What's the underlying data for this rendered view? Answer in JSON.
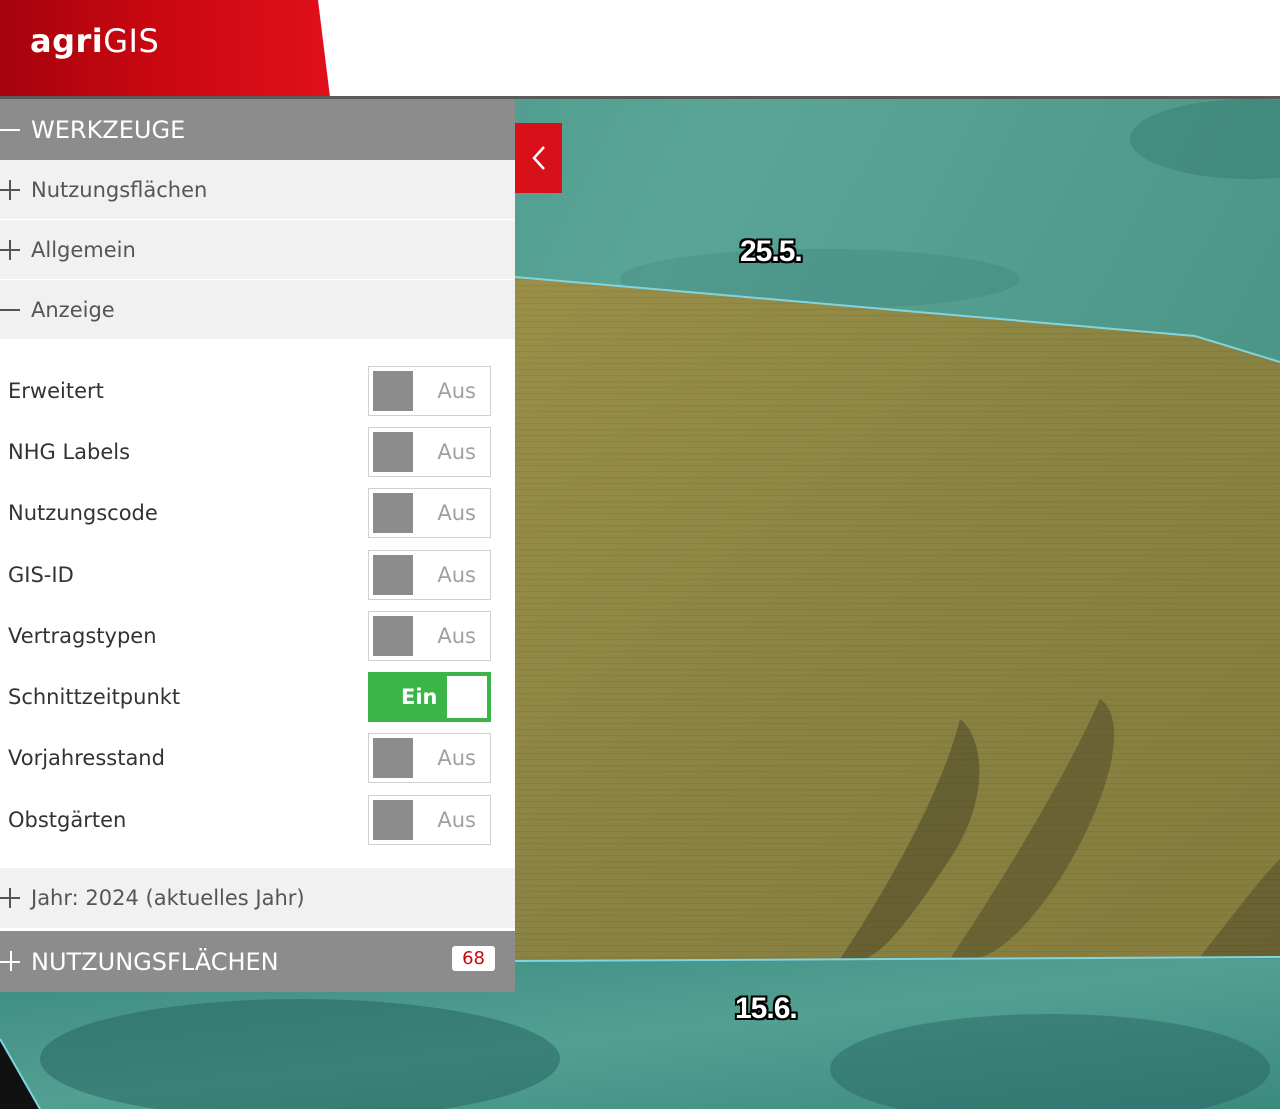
{
  "header": {
    "logo_bold": "agri",
    "logo_regular": "GIS"
  },
  "panel": {
    "werkzeuge_title": "WERKZEUGE",
    "sub_sections": [
      {
        "label": "Nutzungsflächen",
        "state": "collapsed"
      },
      {
        "label": "Allgemein",
        "state": "collapsed"
      },
      {
        "label": "Anzeige",
        "state": "expanded"
      }
    ],
    "settings": [
      {
        "label": "Erweitert",
        "value": "Aus"
      },
      {
        "label": "NHG Labels",
        "value": "Aus"
      },
      {
        "label": "Nutzungscode",
        "value": "Aus"
      },
      {
        "label": "GIS-ID",
        "value": "Aus"
      },
      {
        "label": "Vertragstypen",
        "value": "Aus"
      },
      {
        "label": "Schnittzeitpunkt",
        "value": "Ein"
      },
      {
        "label": "Vorjahresstand",
        "value": "Aus"
      },
      {
        "label": "Obstgärten",
        "value": "Aus"
      }
    ],
    "year_label": "Jahr: 2024 (aktuelles Jahr)",
    "nutzungsflaechen_title": "NUTZUNGSFLÄCHEN",
    "nutzungsflaechen_count": "68"
  },
  "map": {
    "labels": [
      "25.5.",
      "15.6."
    ]
  },
  "colors": {
    "brand_red": "#d8101a",
    "toggle_on": "#3bb54a",
    "panel_header": "#8c8c8c",
    "field_fill": "#8e8a45",
    "meadow": "#4d9b8c"
  },
  "icons": {
    "collapse": "chevron-left-icon",
    "expand": "plus-icon",
    "collapse_section": "minus-icon"
  }
}
